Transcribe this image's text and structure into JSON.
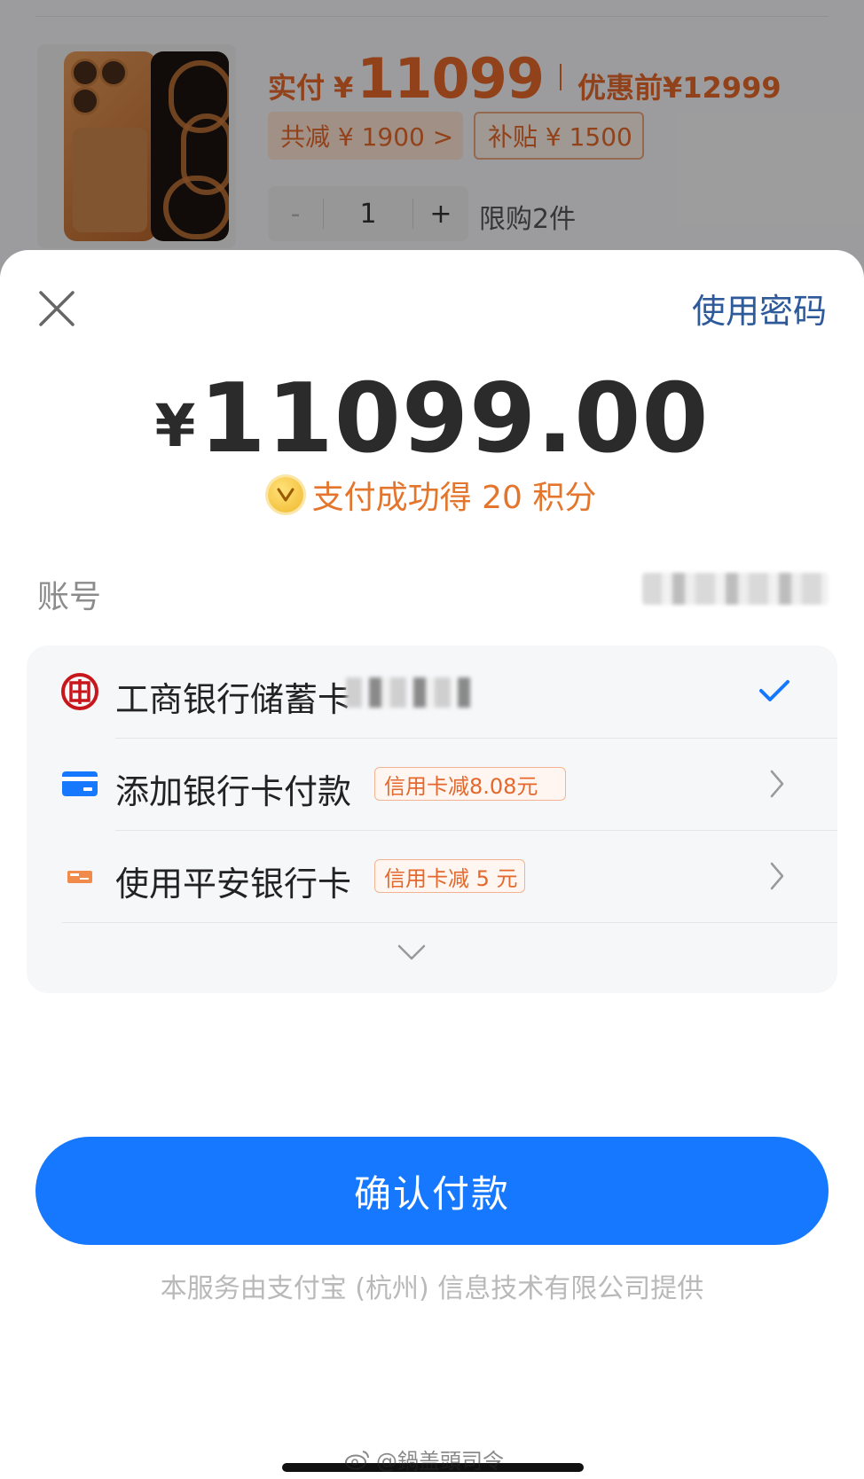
{
  "background": {
    "price_label": "实付",
    "currency": "¥",
    "price": "11099",
    "before_label": "优惠前",
    "before_price": "¥12999",
    "total_discount": "共减 ¥ 1900 >",
    "subsidy": "补贴 ¥ 1500",
    "quantity_minus": "-",
    "quantity": "1",
    "quantity_plus": "+",
    "limit": "限购2件"
  },
  "sheet": {
    "use_password": "使用密码",
    "amount_currency": "¥",
    "amount": "11099.00",
    "points_text": "支付成功得 20 积分",
    "account_label": "账号",
    "methods": [
      {
        "label": "工商银行储蓄卡",
        "selected": true,
        "icon": "icbc-logo-icon"
      },
      {
        "label": "添加银行卡付款",
        "promo": "信用卡减8.08元",
        "icon": "card-icon"
      },
      {
        "label": "使用平安银行卡",
        "promo": "信用卡减 5 元",
        "icon": "pingan-card-icon"
      }
    ],
    "confirm_button": "确认付款",
    "footer": "本服务由支付宝 (杭州) 信息技术有限公司提供"
  },
  "watermark": "@鍋盖頭司令",
  "colors": {
    "primary_blue": "#1677ff",
    "link_blue": "#2f5a9a",
    "promo_orange": "#e4682b",
    "icbc_red": "#c8161d"
  }
}
